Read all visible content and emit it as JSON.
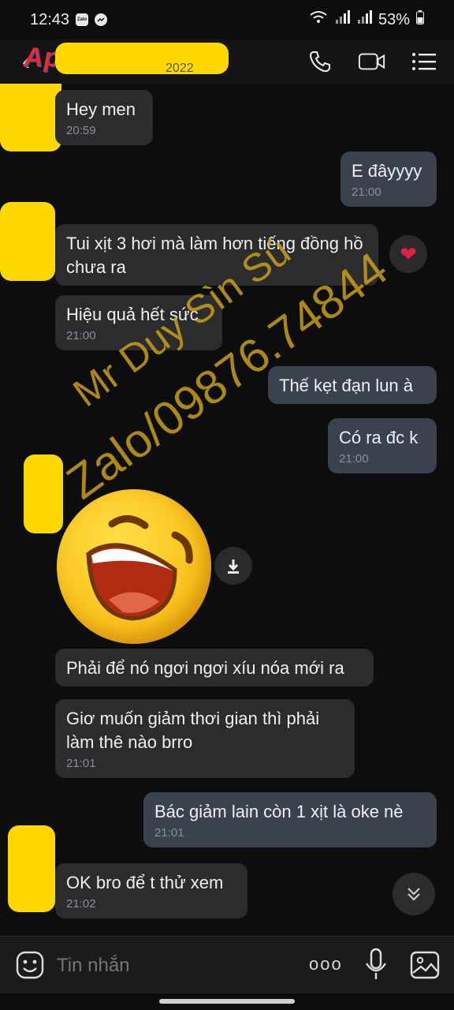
{
  "status_bar": {
    "time": "12:43",
    "battery": "53%",
    "zalo_label": "Zalo"
  },
  "header": {
    "logo_text": "Aphangx",
    "partial_date": "2022"
  },
  "messages": [
    {
      "dir": "in",
      "text": "Hey men",
      "time": "20:59"
    },
    {
      "dir": "out",
      "text": "E đâyyyy",
      "time": "21:00"
    },
    {
      "dir": "in",
      "text": "Tui xịt 3 hơi mà làm hơn tiếng đồng hồ chưa ra",
      "time": ""
    },
    {
      "dir": "in",
      "text": "Hiệu quả hết sức",
      "time": "21:00"
    },
    {
      "dir": "out",
      "text": "Thế kẹt đạn lun à",
      "time": ""
    },
    {
      "dir": "out",
      "text": "Có ra đc k",
      "time": "21:00"
    },
    {
      "dir": "in",
      "text": "Phải để nó ngơi ngơi xíu nóa mới ra",
      "time": ""
    },
    {
      "dir": "in",
      "text": "Giơ muốn giảm thơi gian thì phải làm thê nào brro",
      "time": "21:01"
    },
    {
      "dir": "out",
      "text": "Bác giảm lain còn 1 xịt là oke nè",
      "time": "21:01"
    },
    {
      "dir": "in",
      "text": "OK bro để t thử xem",
      "time": "21:02"
    }
  ],
  "watermark": {
    "line1": "Mr Duy Sìn Sú",
    "line2": "Zalo/09876.74844"
  },
  "composer": {
    "placeholder": "Tin nhắn",
    "more_label": "ooo"
  },
  "colors": {
    "incoming_bubble": "#2c2c2e",
    "outgoing_bubble": "#3a4250",
    "watermark": "#c8a014",
    "reaction_heart": "#e02040"
  }
}
